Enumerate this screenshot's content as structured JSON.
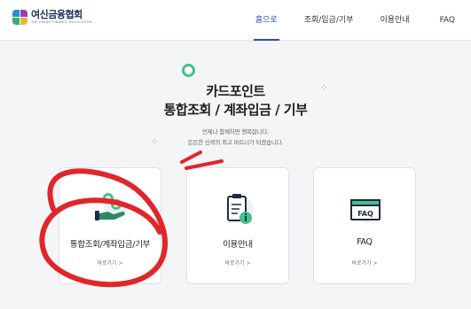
{
  "header": {
    "logo_ko": "여신금융협회",
    "logo_en": "THE CREDIT FINANCE ASSOCIATION",
    "nav": [
      {
        "label": "홈으로",
        "active": true
      },
      {
        "label": "조회/입금/기부",
        "active": false
      },
      {
        "label": "이용안내",
        "active": false
      },
      {
        "label": "FAQ",
        "active": false
      }
    ]
  },
  "hero": {
    "title_line1": "카드포인트",
    "title_line2": "통합조회 / 계좌입금 / 기부",
    "sub_line1": "언제나 함께하면 행복합니다.",
    "sub_line2": "든든한 신뢰의 최고 파트너가 되겠습니다."
  },
  "cards": [
    {
      "label": "통합조회/계좌입금/기부",
      "link": "바로가기 >",
      "icon": "hand-coins-icon"
    },
    {
      "label": "이용안내",
      "link": "바로가기 >",
      "icon": "clipboard-info-icon"
    },
    {
      "label": "FAQ",
      "link": "바로가기 >",
      "icon": "faq-window-icon"
    }
  ],
  "faq_icon_text": "FAQ",
  "colors": {
    "accent": "#2b4fb3",
    "green": "#45c08a",
    "annotation": "#e0262b"
  }
}
